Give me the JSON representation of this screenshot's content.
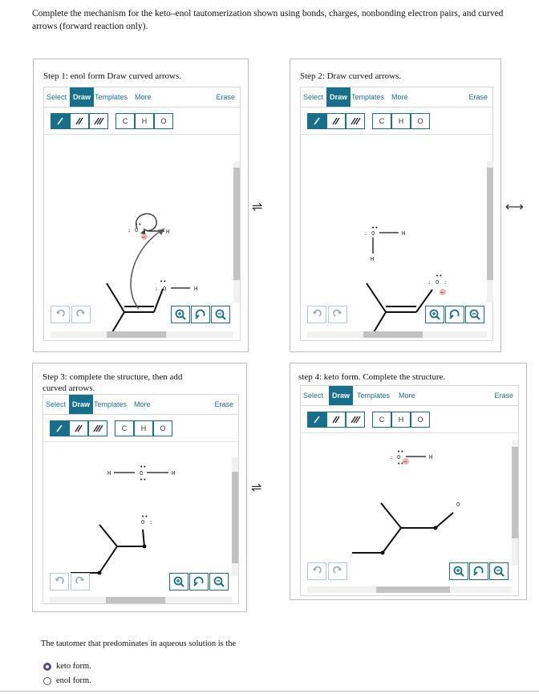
{
  "prompt": "Complete the mechanism for the keto–enol tautomerization shown using bonds, charges, nonbonding electron pairs, and curved arrows (forward reaction only).",
  "steps": [
    {
      "title": "Step 1: enol form Draw curved arrows."
    },
    {
      "title": "Step 2: Draw curved arrows."
    },
    {
      "title": "Step 3: complete the structure, then add curved arrows."
    },
    {
      "title": "step 4: keto form. Complete the structure."
    }
  ],
  "toolbar": {
    "select": "Select",
    "draw": "Draw",
    "templates": "Templates",
    "more": "More",
    "erase": "Erase",
    "atoms": [
      "C",
      "H",
      "O"
    ]
  },
  "arrows": {
    "equilibrium": "⇌",
    "resonance": "⟷"
  },
  "atoms": {
    "O": "O",
    "H": "H",
    "lp": "••",
    "colon": ":",
    "minus": "−"
  },
  "question": {
    "text": "The tautomer that predominates in aqueous solution is the",
    "options": [
      {
        "label": "keto form.",
        "selected": true
      },
      {
        "label": "enol form.",
        "selected": false
      }
    ]
  },
  "colors": {
    "accent": "#16708c",
    "charge": "#f2b6b6",
    "radio": "#5a4a8a"
  }
}
